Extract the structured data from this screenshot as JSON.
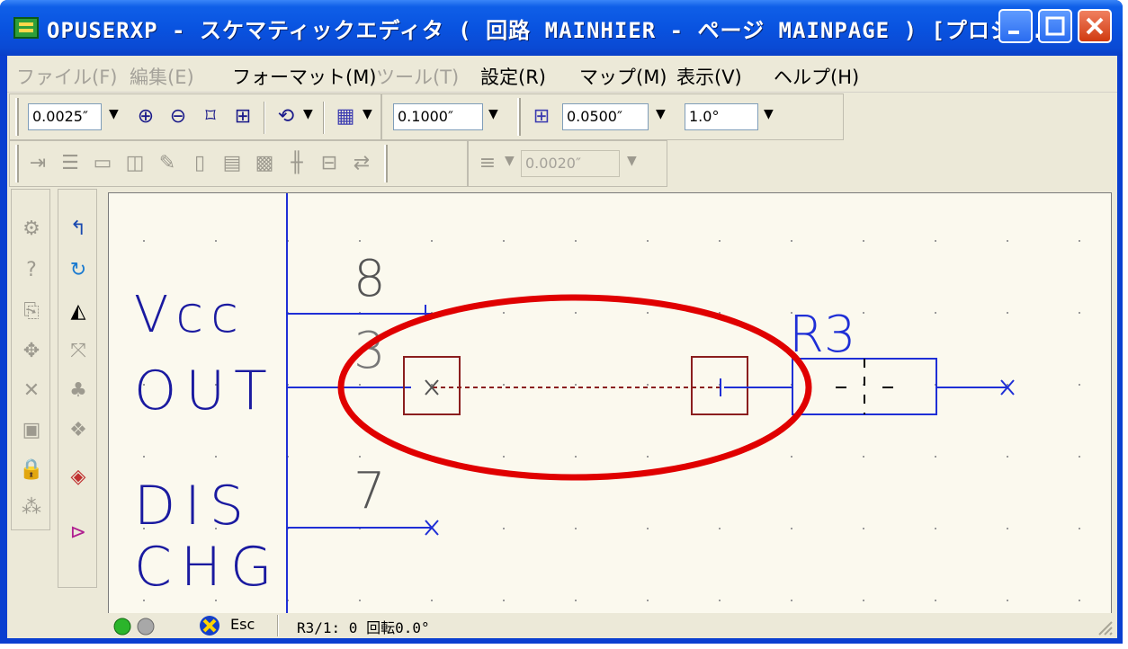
{
  "window": {
    "title": "OPUSERXP - スケマティックエディタ ( 回路 MAINHIER - ページ MAINPAGE ) [プロジェ…"
  },
  "menu": [
    {
      "label": "ファイル(F)",
      "enabled": false
    },
    {
      "label": "編集(E)",
      "enabled": false
    },
    {
      "label": "フォーマット(M)",
      "enabled": true
    },
    {
      "label": "ツール(T)",
      "enabled": false
    },
    {
      "label": "設定(R)",
      "enabled": true
    },
    {
      "label": "マップ(M)",
      "enabled": true
    },
    {
      "label": "表示(V)",
      "enabled": true
    },
    {
      "label": "ヘルプ(H)",
      "enabled": true
    }
  ],
  "toolbar1": {
    "zoom_value": "0.0025″",
    "grid_value": "0.1000″",
    "snap_value": "0.0500″",
    "angle_value": "1.0°"
  },
  "toolbar2": {
    "line_width_value": "0.0020″"
  },
  "schematic": {
    "pins": [
      {
        "number": "8",
        "name": "Vcc"
      },
      {
        "number": "3",
        "name": "OUT"
      },
      {
        "number": "7",
        "name": "DIS CHG"
      }
    ],
    "labels": {
      "vcc": "Vcc",
      "out": "OUT",
      "dis": "DIS",
      "chg": "CHG",
      "pin8": "8",
      "pin3": "3",
      "pin7": "7",
      "ref": "R3"
    },
    "colors": {
      "wire": "#1f2fd6",
      "symbol": "#1a1aa0",
      "pin_number": "#555555",
      "highlight_box": "#8b1e1e",
      "ellipse": "#e00000",
      "canvas": "#fbf9ee"
    }
  },
  "status": {
    "esc_label": "Esc",
    "text": "R3/1: 0 回転0.0°"
  }
}
